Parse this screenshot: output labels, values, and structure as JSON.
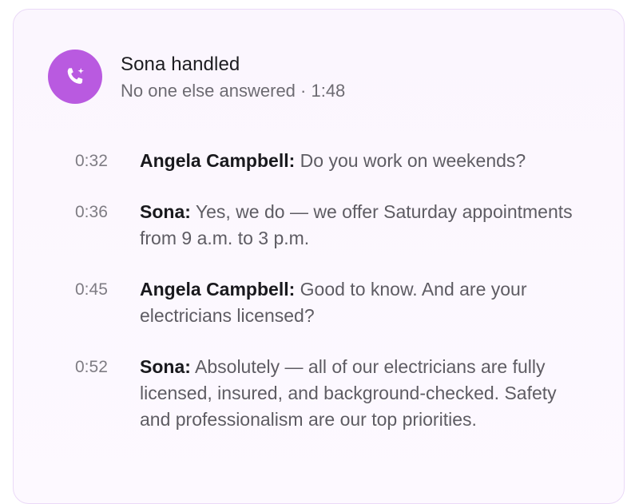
{
  "header": {
    "icon": "phone-ai-icon",
    "title": "Sona handled",
    "subtitle": "No one else answered · 1:48",
    "accent_color": "#b95ae0"
  },
  "transcript": [
    {
      "time": "0:32",
      "speaker": "Angela Campbell:",
      "text": "Do you work on weekends?"
    },
    {
      "time": "0:36",
      "speaker": "Sona:",
      "text": "Yes, we do — we offer Saturday appointments from 9 a.m. to 3 p.m."
    },
    {
      "time": "0:45",
      "speaker": "Angela Campbell:",
      "text": "Good to know. And are your electricians licensed?"
    },
    {
      "time": "0:52",
      "speaker": "Sona:",
      "text": "Absolutely — all of our electricians are fully licensed, insured, and background-checked. Safety and professionalism are our top priorities."
    }
  ]
}
